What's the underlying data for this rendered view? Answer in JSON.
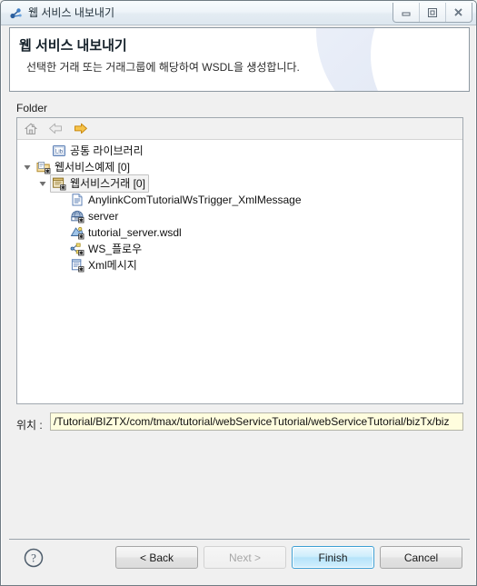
{
  "window": {
    "title": "웹 서비스 내보내기",
    "title_icon": "webservice-link-icon",
    "controls": {
      "minimize": "minimize-icon",
      "maximize": "maximize-icon",
      "close": "close-icon"
    }
  },
  "banner": {
    "heading": "웹 서비스 내보내기",
    "description": "선택한 거래 또는 거래그룹에 해당하여 WSDL을 생성합니다."
  },
  "folder_group": {
    "label": "Folder",
    "toolbar": [
      {
        "name": "home-icon",
        "enabled": false
      },
      {
        "name": "back-arrow-icon",
        "enabled": false
      },
      {
        "name": "forward-arrow-icon",
        "enabled": true
      }
    ],
    "tree": [
      {
        "label": "공통 라이브러리",
        "icon": "library-icon",
        "depth": 1,
        "twisty": "none",
        "selected": false
      },
      {
        "label": "웹서비스예제 [0]",
        "icon": "project-folder-icon",
        "depth": 0,
        "twisty": "expanded",
        "selected": false
      },
      {
        "label": "웹서비스거래 [0]",
        "icon": "transaction-group-icon",
        "depth": 1,
        "twisty": "expanded",
        "selected": true
      },
      {
        "label": "AnylinkComTutorialWsTrigger_XmlMessage",
        "icon": "document-icon",
        "depth": 3,
        "twisty": "none",
        "selected": false
      },
      {
        "label": "server",
        "icon": "web-service-icon",
        "depth": 3,
        "twisty": "none",
        "selected": false
      },
      {
        "label": "tutorial_server.wsdl",
        "icon": "wsdl-icon",
        "depth": 3,
        "twisty": "none",
        "selected": false
      },
      {
        "label": "WS_플로우",
        "icon": "flow-icon",
        "depth": 3,
        "twisty": "none",
        "selected": false
      },
      {
        "label": "Xml메시지",
        "icon": "xml-message-icon",
        "depth": 3,
        "twisty": "none",
        "selected": false
      }
    ]
  },
  "location": {
    "label": "위치 :",
    "value": "/Tutorial/BIZTX/com/tmax/tutorial/webServiceTutorial/webServiceTutorial/bizTx/biz",
    "placeholder": ""
  },
  "footer": {
    "help_icon": "help-question-icon",
    "buttons": [
      {
        "label": "< Back",
        "state": "normal",
        "name": "back-button"
      },
      {
        "label": "Next >",
        "state": "disabled",
        "name": "next-button"
      },
      {
        "label": "Finish",
        "state": "default",
        "name": "finish-button"
      },
      {
        "label": "Cancel",
        "state": "normal",
        "name": "cancel-button"
      }
    ]
  },
  "colors": {
    "accent": "#3c9fd4",
    "field_background": "#fffdde",
    "window_background": "#f0f0f0",
    "forward_arrow": "#f0a81e"
  }
}
